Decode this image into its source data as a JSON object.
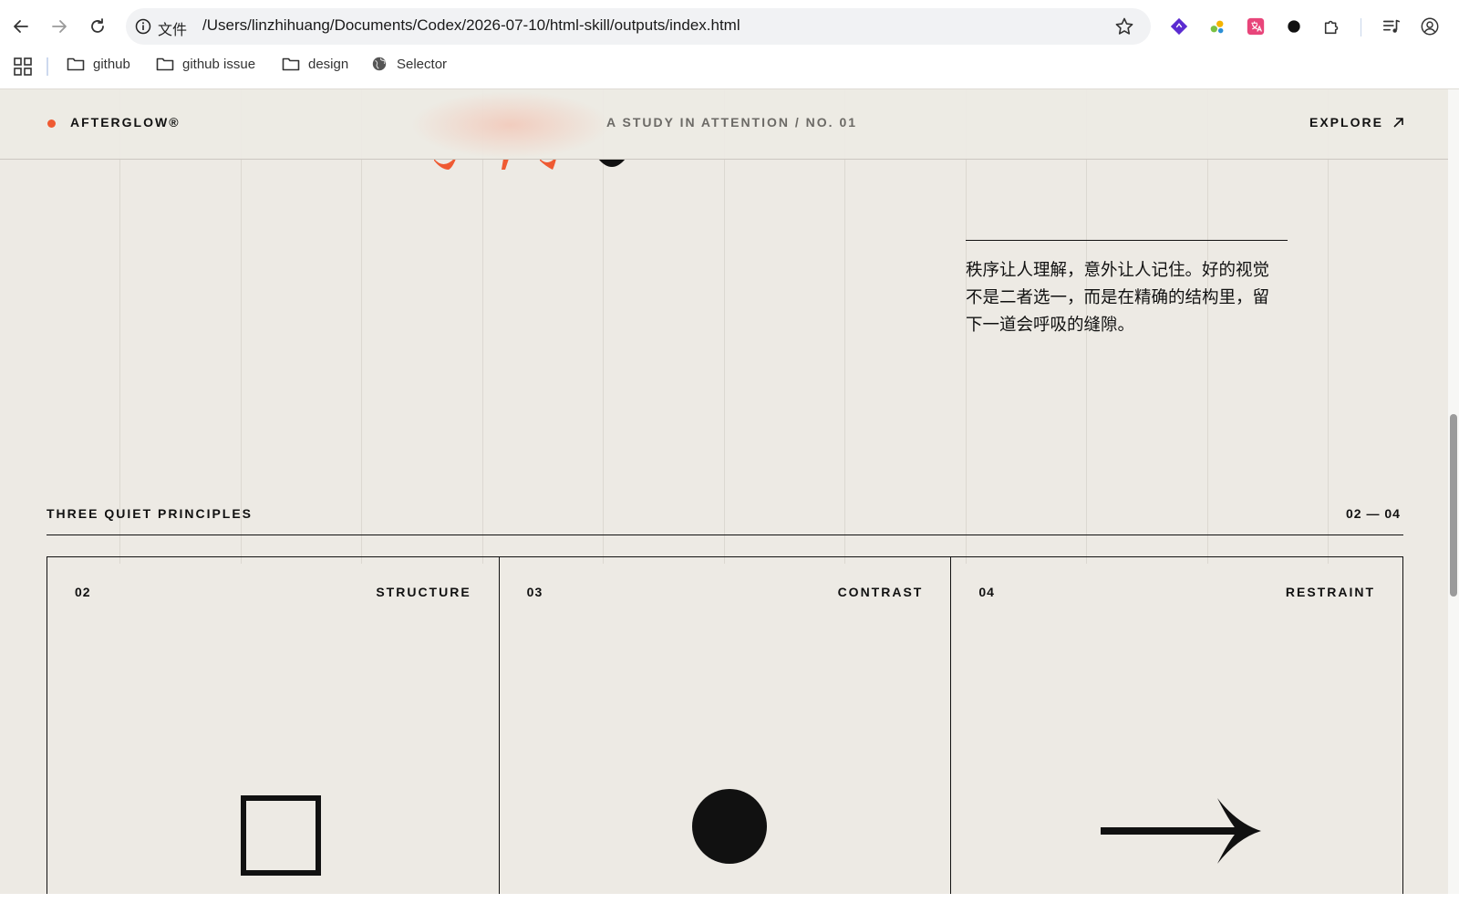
{
  "browser": {
    "url": "/Users/linzhihuang/Documents/Codex/2026-07-10/html-skill/outputs/index.html",
    "site_info_label": "文件",
    "bookmarks": [
      {
        "label": "github",
        "icon": "folder-icon"
      },
      {
        "label": "github issue",
        "icon": "folder-icon"
      },
      {
        "label": "design",
        "icon": "folder-icon"
      },
      {
        "label": "Selector",
        "icon": "globe-icon"
      }
    ]
  },
  "header": {
    "brand": "AFTERGLOW®",
    "tagline": "A STUDY IN ATTENTION / NO. 01",
    "cta": "EXPLORE"
  },
  "quote": {
    "text": "秩序让人理解，意外让人记住。好的视觉不是二者选一，而是在精确的结构里，留下一道会呼吸的缝隙。"
  },
  "principles": {
    "label": "THREE QUIET PRINCIPLES",
    "count": "02 — 04",
    "cards": [
      {
        "number": "02",
        "title": "STRUCTURE",
        "shape": "square"
      },
      {
        "number": "03",
        "title": "CONTRAST",
        "shape": "circle"
      },
      {
        "number": "04",
        "title": "RESTRAINT",
        "shape": "arrow"
      }
    ]
  },
  "colors": {
    "accent": "#ef5a32",
    "paper": "#edeae4",
    "ink": "#111111"
  }
}
